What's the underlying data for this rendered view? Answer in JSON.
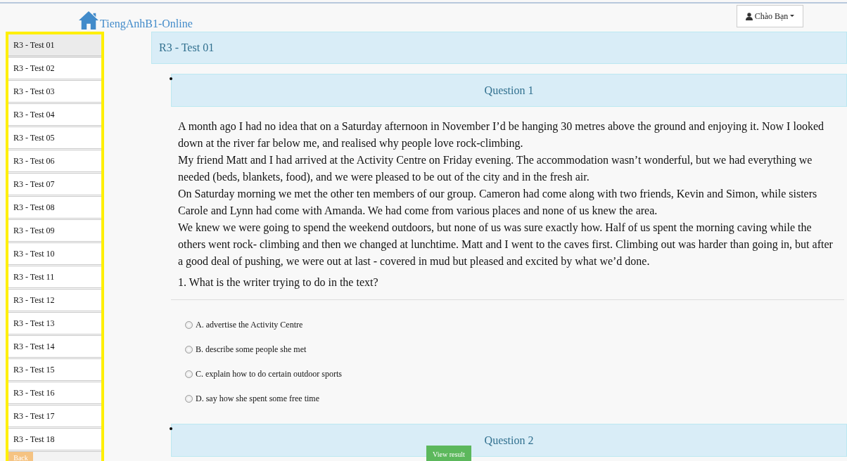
{
  "header": {
    "logo": "TiengAnhB1-Online",
    "user_menu": "Chào Bạn"
  },
  "sidebar": {
    "items": [
      {
        "label": "R3 - Test 01",
        "selected": true
      },
      {
        "label": "R3 - Test 02",
        "selected": false
      },
      {
        "label": "R3 - Test 03",
        "selected": false
      },
      {
        "label": "R3 - Test 04",
        "selected": false
      },
      {
        "label": "R3 - Test 05",
        "selected": false
      },
      {
        "label": "R3 - Test 06",
        "selected": false
      },
      {
        "label": "R3 - Test 07",
        "selected": false
      },
      {
        "label": "R3 - Test 08",
        "selected": false
      },
      {
        "label": "R3 - Test 09",
        "selected": false
      },
      {
        "label": "R3 - Test 10",
        "selected": false
      },
      {
        "label": "R3 - Test 11",
        "selected": false
      },
      {
        "label": "R3 - Test 12",
        "selected": false
      },
      {
        "label": "R3 - Test 13",
        "selected": false
      },
      {
        "label": "R3 - Test 14",
        "selected": false
      },
      {
        "label": "R3 - Test 15",
        "selected": false
      },
      {
        "label": "R3 - Test 16",
        "selected": false
      },
      {
        "label": "R3 - Test 17",
        "selected": false
      },
      {
        "label": "R3 - Test 18",
        "selected": false
      }
    ],
    "back_button": "Back"
  },
  "page_title": "R3 - Test 01",
  "questions": [
    {
      "title": "Question 1",
      "passage": [
        "A month ago I had no idea that on a Saturday afternoon in November I’d be hanging 30 metres above the ground and enjoying it. Now I looked down at the river far below me, and realised why people love rock-climbing.",
        "My friend Matt and I had arrived at the Activity Centre on Friday evening. The accommodation wasn’t wonderful, but we had everything we needed (beds, blankets, food), and we were pleased to be out of the city and in the fresh air.",
        "On Saturday morning we met the other ten members of our group. Cameron had come along with two friends, Kevin and Simon, while sisters Carole and Lynn had come with Amanda. We had come from various places and none of us knew the area.",
        "We knew we were going to spend the weekend outdoors, but none of us was sure exactly how. Half of us spent the morning caving while the others went rock- climbing and then we changed at lunchtime. Matt and I went to the caves first. Climbing out was harder than going in, but after a good deal of pushing, we were out at last - covered in mud but pleased and excited by what we’d done."
      ],
      "prompt": "1. What is the writer trying to do in the text?",
      "options": [
        {
          "label": "A. advertise the Activity Centre",
          "selected": false
        },
        {
          "label": "B. describe some people she met",
          "selected": false
        },
        {
          "label": "C. explain how to do certain outdoor sports",
          "selected": false
        },
        {
          "label": "D. say how she spent some free time",
          "selected": false
        }
      ]
    },
    {
      "title": "Question 2"
    }
  ],
  "view_result_button": "View result"
}
